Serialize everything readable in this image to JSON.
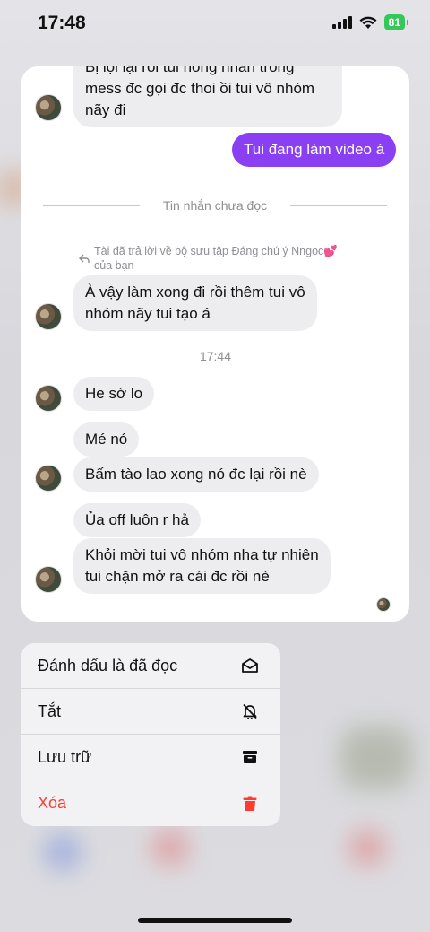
{
  "status_bar": {
    "time": "17:48",
    "battery": "81"
  },
  "chat": {
    "messages": [
      {
        "text_line1": "Bị lọi lại rồi tui hồng nhắn trong",
        "text_line2": "mess đc gọi đc thoi ồi tui vô nhóm",
        "text_line3": "nãy đi"
      },
      {
        "text": "Tui đang làm video á"
      },
      {
        "text_line1": "À vậy làm xong đi rồi thêm tui vô",
        "text_line2": "nhóm nãy tui tạo á"
      },
      {
        "text": "He sờ lo"
      },
      {
        "text": "Mé nó"
      },
      {
        "text": "Bấm tào lao xong nó đc lại rồi nè"
      },
      {
        "text": "Ủa off luôn r hả"
      },
      {
        "text_line1": "Khỏi mời tui vô nhóm nha tự nhiên",
        "text_line2": "tui chặn mở ra cái đc rồi nè"
      }
    ],
    "unread_divider": "Tin nhắn chưa đọc",
    "reply_note_line1": "Tài đã trả lời về bộ sưu tập Đáng chú ý Nngoc💕",
    "reply_note_line2": "của bạn",
    "timestamp": "17:44"
  },
  "menu": {
    "items": [
      {
        "label": "Đánh dấu là đã đọc",
        "icon": "envelope-open-icon"
      },
      {
        "label": "Tắt",
        "icon": "bell-slash-icon"
      },
      {
        "label": "Lưu trữ",
        "icon": "archive-icon"
      },
      {
        "label": "Xóa",
        "icon": "trash-icon"
      }
    ]
  },
  "colors": {
    "accent": "#8a3ff2",
    "danger": "#ff3b30",
    "battery": "#34c759"
  }
}
